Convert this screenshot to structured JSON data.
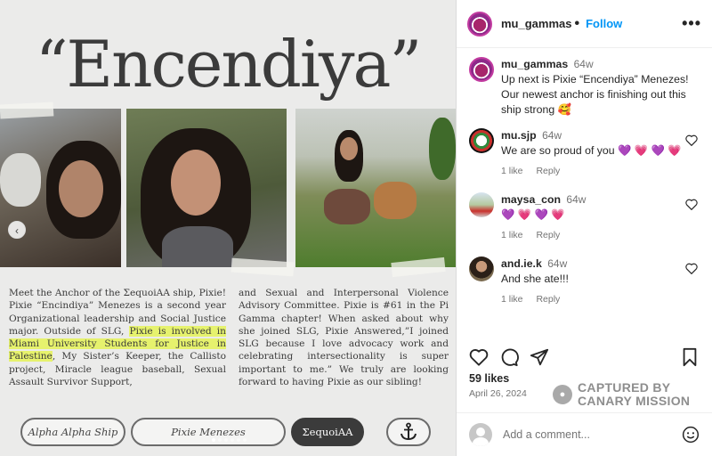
{
  "post_image": {
    "title": "“Encendiya”",
    "bio_left_part1": "Meet the Anchor of the ΣequoiAA ship, Pixie! Pixie “Encindiya” Menezes is a second year Organizational leadership and Social Justice major. Outside of SLG, ",
    "bio_left_highlight": "Pixie is involved in Miami University Students for Justice in Palestine",
    "bio_left_part2": ", My Sister’s Keeper, the Callisto project, Miracle league baseball, Sexual Assault Survivor Support,",
    "bio_right": "and Sexual and Interpersonal Violence Advisory Committee. Pixie is #61 in the Pi Gamma chapter! When asked about why she joined SLG, Pixie Answered,”I joined SLG because I love advocacy work and celebrating intersectionality is super important to me.” We truly are looking forward to having Pixie as our sibling!",
    "pills": {
      "ship": "Alpha Alpha Ship",
      "name": "Pixie Menezes",
      "line": "ΣequoiAA",
      "anchor_icon": "anchor-icon"
    },
    "prev_arrow": "‹",
    "highlight_color": "#e6f26d"
  },
  "header": {
    "username": "mu_gammas",
    "separator": "•",
    "follow": "Follow",
    "more": "•••"
  },
  "caption": {
    "username": "mu_gammas",
    "time": "64w",
    "text": "Up next is Pixie “Encendiya” Menezes! Our newest anchor is finishing out this ship strong",
    "emoji": "🥰"
  },
  "comments": [
    {
      "username": "mu.sjp",
      "time": "64w",
      "text": "We are so proud of you 💜 💗 💜 💗",
      "likes": "1 like",
      "reply": "Reply"
    },
    {
      "username": "maysa_con",
      "time": "64w",
      "text": "💜 💗 💜 💗",
      "likes": "1 like",
      "reply": "Reply"
    },
    {
      "username": "and.ie.k",
      "time": "64w",
      "text": "And she ate!!!",
      "likes": "1 like",
      "reply": "Reply"
    }
  ],
  "stats": {
    "likes": "59 likes",
    "date": "April 26, 2024"
  },
  "watermark": {
    "line1": "CAPTURED BY",
    "line2": "CANARY MISSION"
  },
  "add_comment": {
    "placeholder": "Add a comment..."
  },
  "colors": {
    "accent": "#0095f6",
    "text": "#262626",
    "muted": "#737373"
  }
}
